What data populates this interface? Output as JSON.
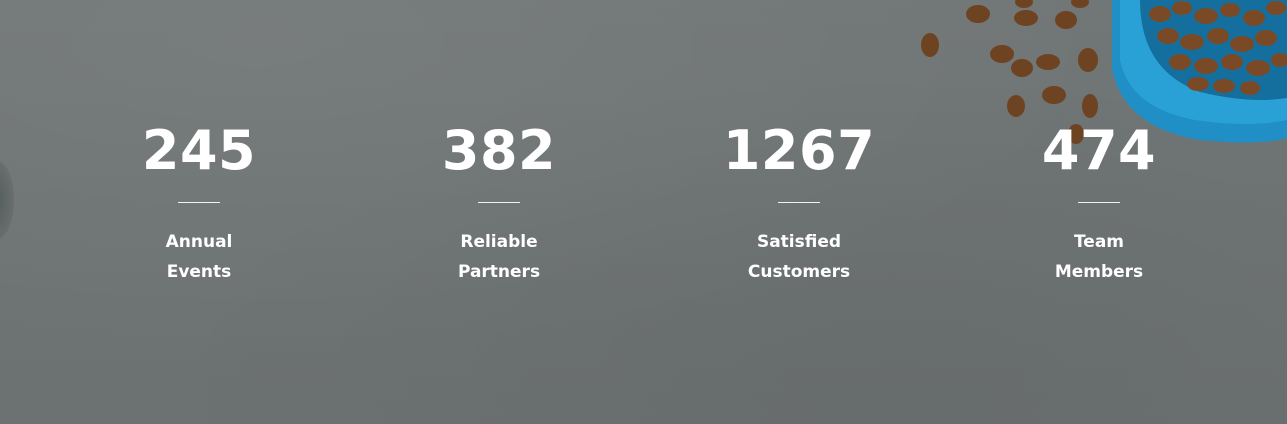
{
  "stats": [
    {
      "number": "245",
      "label_line1": "Annual",
      "label_line2": "Events"
    },
    {
      "number": "382",
      "label_line1": "Reliable",
      "label_line2": "Partners"
    },
    {
      "number": "1267",
      "label_line1": "Satisfied",
      "label_line2": "Customers"
    },
    {
      "number": "474",
      "label_line1": "Team",
      "label_line2": "Members"
    }
  ],
  "colors": {
    "background": "#6f7474",
    "text": "#ffffff",
    "bowl": "#1e8fc4",
    "kibble": "#7a4a26"
  },
  "decor": {
    "image_icon": "pet-food-bowl-icon"
  }
}
